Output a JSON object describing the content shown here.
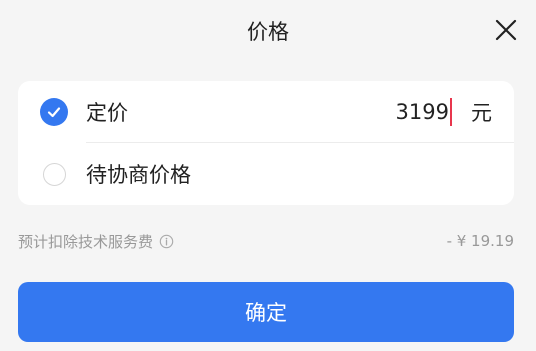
{
  "dialog": {
    "title": "价格",
    "close_icon": "close-icon"
  },
  "options": [
    {
      "label": "定价",
      "checked": true,
      "value": "3199",
      "unit": "元"
    },
    {
      "label": "待协商价格",
      "checked": false
    }
  ],
  "fee": {
    "label": "预计扣除技术服务费",
    "info_icon": "info-icon",
    "value": "- ¥ 19.19"
  },
  "confirm": {
    "label": "确定"
  },
  "colors": {
    "accent": "#3478f0",
    "caret": "#e8364d",
    "background": "#f5f5f5"
  }
}
